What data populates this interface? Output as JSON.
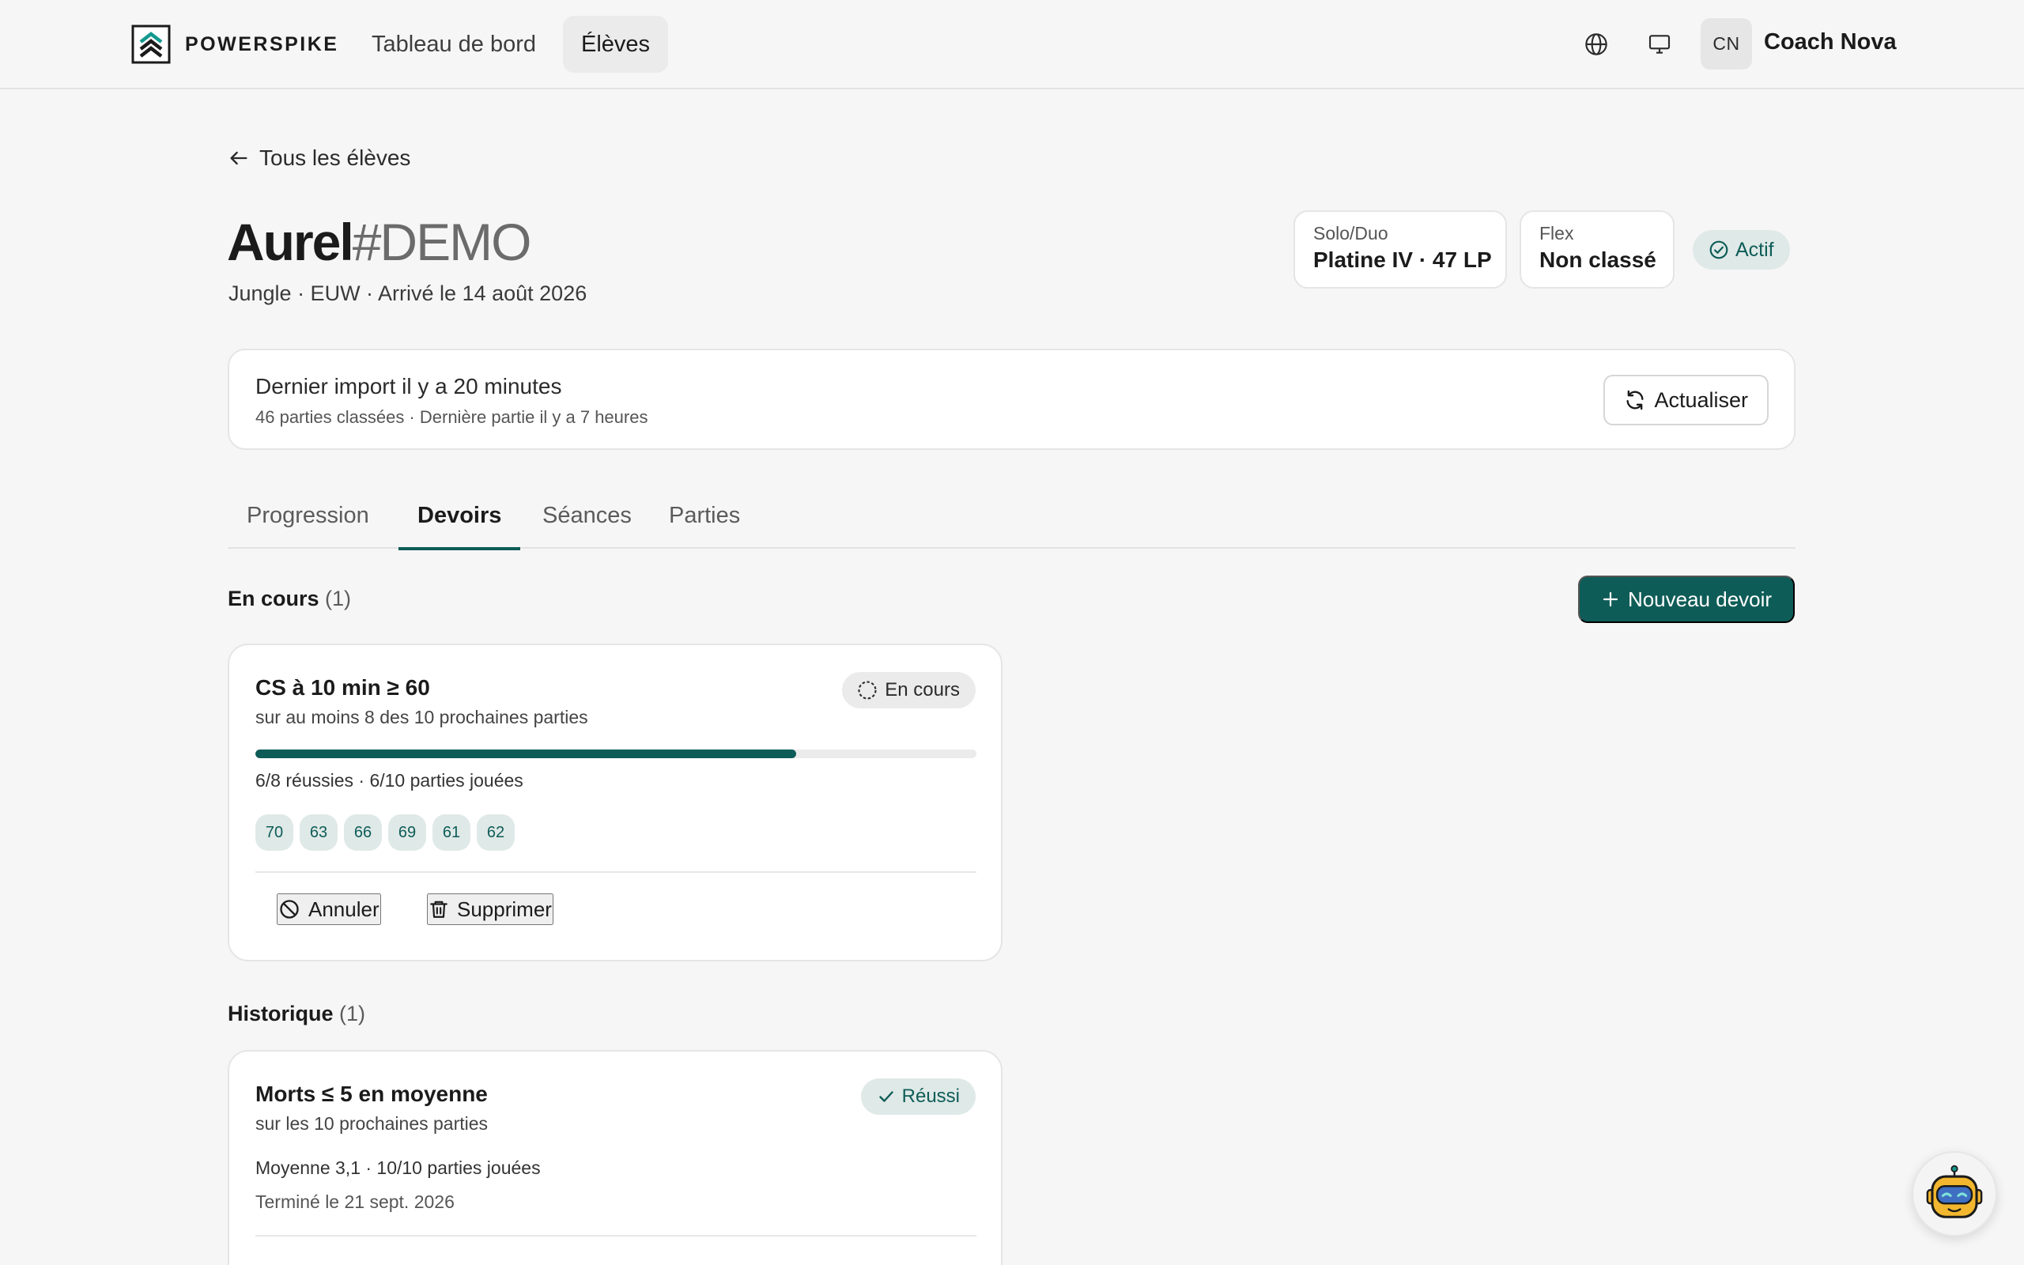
{
  "brand": {
    "name": "POWERSPIKE"
  },
  "nav": {
    "dashboard": "Tableau de bord",
    "students": "Élèves"
  },
  "user": {
    "initials": "CN",
    "name": "Coach Nova"
  },
  "back": {
    "label": "Tous les élèves"
  },
  "player": {
    "name": "Aurel",
    "tag": "#DEMO",
    "meta": "Jungle · EUW · Arrivé le 14 août 2026",
    "status": "Actif"
  },
  "ranks": {
    "solo": {
      "label": "Solo/Duo",
      "value": "Platine IV · 47 LP"
    },
    "flex": {
      "label": "Flex",
      "value": "Non classé"
    }
  },
  "import": {
    "title": "Dernier import il y a 20 minutes",
    "subtitle": "46 parties classées · Dernière partie il y a 7 heures",
    "refresh_label": "Actualiser"
  },
  "tabs": [
    "Progression",
    "Devoirs",
    "Séances",
    "Parties"
  ],
  "active_tab": "Devoirs",
  "current": {
    "title": "En cours",
    "count": "(1)",
    "new_button": "Nouveau devoir",
    "assignment": {
      "title": "CS à 10 min ≥ 60",
      "subtitle": "sur au moins 8 des 10 prochaines parties",
      "status": "En cours",
      "progress": 0.75,
      "progress_text": "6/8 réussies · 6/10 parties jouées",
      "values": [
        "70",
        "63",
        "66",
        "69",
        "61",
        "62"
      ],
      "cancel_label": "Annuler",
      "delete_label": "Supprimer"
    }
  },
  "history": {
    "title": "Historique",
    "count": "(1)",
    "assignment": {
      "title": "Morts ≤ 5 en moyenne",
      "subtitle": "sur les 10 prochaines parties",
      "status": "Réussi",
      "line1": "Moyenne 3,1 · 10/10 parties jouées",
      "line2": "Terminé le 21 sept. 2026"
    }
  },
  "colors": {
    "accent": "#0e5c57",
    "accent_soft": "#dfe9e7",
    "background": "#f6f6f6"
  },
  "icons": [
    "globe-icon",
    "monitor-icon",
    "arrow-left-icon",
    "check-circle-icon",
    "refresh-icon",
    "plus-icon",
    "dashed-circle-icon",
    "ban-icon",
    "trash-icon",
    "check-icon",
    "robot-icon"
  ]
}
